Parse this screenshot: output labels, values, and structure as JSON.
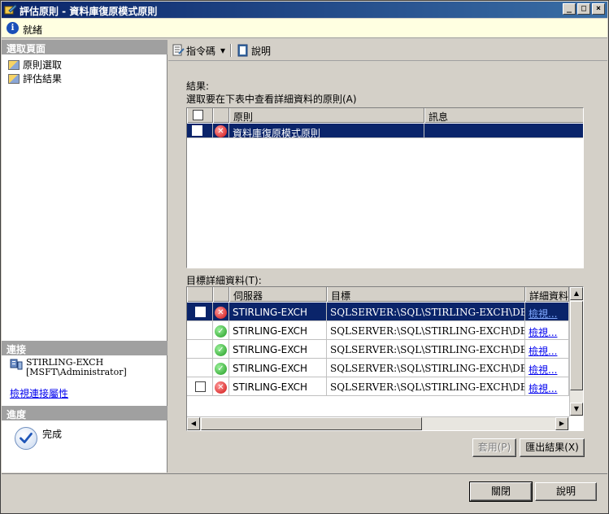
{
  "window": {
    "title": "評估原則 - 資料庫復原模式原則",
    "minimize_label": "_",
    "maximize_label": "□",
    "close_label": "×"
  },
  "status": {
    "text": "就緒"
  },
  "left": {
    "select_page_header": "選取頁面",
    "nav_items": [
      {
        "label": "原則選取"
      },
      {
        "label": "評估結果"
      }
    ],
    "connection_header": "連接",
    "connection_server": "STIRLING-EXCH",
    "connection_user": "[MSFT\\Administrator]",
    "connection_link": "檢視連接屬性",
    "progress_header": "進度",
    "progress_text": "完成"
  },
  "toolbar": {
    "script_label": "指令碼",
    "script_dropdown": "▾",
    "help_label": "說明"
  },
  "results": {
    "label": "結果:",
    "instruction": "選取要在下表中查看詳細資料的原則(A)",
    "columns": [
      "原則",
      "訊息"
    ],
    "rows": [
      {
        "policy": "資料庫復原模式原則",
        "message": "",
        "status": "error"
      }
    ]
  },
  "details": {
    "label": "目標詳細資料(T):",
    "columns": [
      "伺服器",
      "目標",
      "詳細資料"
    ],
    "rows": [
      {
        "server": "STIRLING-EXCH",
        "target": "SQLSERVER:\\SQL\\STIRLING-EXCH\\DEFAUL...",
        "detail": "檢視...",
        "status": "error",
        "checkbox": true
      },
      {
        "server": "STIRLING-EXCH",
        "target": "SQLSERVER:\\SQL\\STIRLING-EXCH\\DEFAUL...",
        "detail": "檢視...",
        "status": "ok",
        "checkbox": false
      },
      {
        "server": "STIRLING-EXCH",
        "target": "SQLSERVER:\\SQL\\STIRLING-EXCH\\DEFAUL...",
        "detail": "檢視...",
        "status": "ok",
        "checkbox": false
      },
      {
        "server": "STIRLING-EXCH",
        "target": "SQLSERVER:\\SQL\\STIRLING-EXCH\\DEFAUL...",
        "detail": "檢視...",
        "status": "ok",
        "checkbox": false
      },
      {
        "server": "STIRLING-EXCH",
        "target": "SQLSERVER:\\SQL\\STIRLING-EXCH\\DEFAUL...",
        "detail": "檢視...",
        "status": "error",
        "checkbox": true
      }
    ]
  },
  "buttons": {
    "apply": "套用(P)",
    "export": "匯出結果(X)",
    "close": "關閉",
    "help": "說明"
  }
}
